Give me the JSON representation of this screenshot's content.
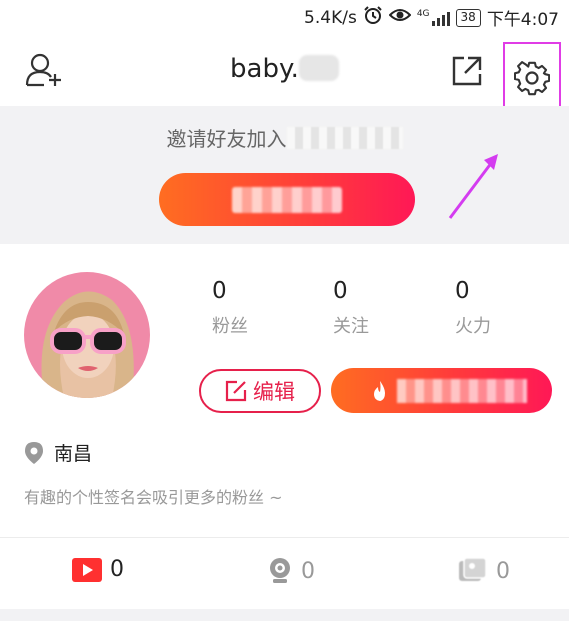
{
  "status_bar": {
    "speed": "5.4K/s",
    "network": "4G",
    "battery": "38",
    "time": "下午4:07"
  },
  "header": {
    "username": "baby."
  },
  "invite": {
    "text": "邀请好友加入"
  },
  "profile": {
    "stats": [
      {
        "value": "0",
        "label": "粉丝"
      },
      {
        "value": "0",
        "label": "关注"
      },
      {
        "value": "0",
        "label": "火力"
      }
    ],
    "edit_label": "编辑",
    "location": "南昌",
    "bio": "有趣的个性签名会吸引更多的粉丝 ~"
  },
  "tabs": [
    {
      "icon": "video-icon",
      "count": "0",
      "color": "#222"
    },
    {
      "icon": "camera-icon",
      "count": "0",
      "color": "#999"
    },
    {
      "icon": "photo-icon",
      "count": "0",
      "color": "#999"
    }
  ],
  "colors": {
    "accent": "#ff3b3b",
    "highlight_box": "#e03ce6"
  }
}
